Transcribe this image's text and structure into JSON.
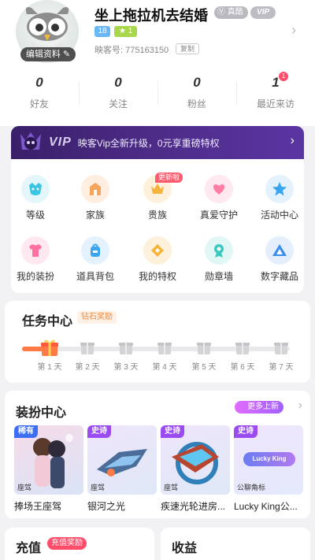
{
  "profile": {
    "username": "坐上拖拉机去结婚",
    "real_badge": "真酷",
    "vip_badge": "VIP",
    "edit_label": "编辑资料",
    "level": "18",
    "star_level": "1",
    "account": "映客号: 775163150",
    "copy_label": "复制"
  },
  "stats": [
    {
      "value": "0",
      "label": "好友"
    },
    {
      "value": "0",
      "label": "关注"
    },
    {
      "value": "0",
      "label": "粉丝"
    },
    {
      "value": "1",
      "label": "最近来访",
      "badge": "1"
    }
  ],
  "vip_banner": {
    "logo_text": "VIP",
    "text": "映客Vip全新升级，0元享重磅特权"
  },
  "grid": [
    {
      "label": "等级",
      "icon": "level-icon",
      "color": "#39c6e3"
    },
    {
      "label": "家族",
      "icon": "family-icon",
      "color": "#f6a65c"
    },
    {
      "label": "贵族",
      "icon": "crown-icon",
      "color": "#f6b33b",
      "tag": "更新啦"
    },
    {
      "label": "真爱守护",
      "icon": "heart-guard-icon",
      "color": "#ff7fa5"
    },
    {
      "label": "活动中心",
      "icon": "star-icon",
      "color": "#3aa6f0"
    },
    {
      "label": "我的装扮",
      "icon": "tshirt-icon",
      "color": "#ff6fa0"
    },
    {
      "label": "道具背包",
      "icon": "backpack-icon",
      "color": "#3aa6f0"
    },
    {
      "label": "我的特权",
      "icon": "diamond-icon",
      "color": "#f6b33b"
    },
    {
      "label": "勋章墙",
      "icon": "medal-icon",
      "color": "#3ac9c0"
    },
    {
      "label": "数字藏品",
      "icon": "collectible-icon",
      "color": "#3a8cf0"
    }
  ],
  "task_center": {
    "title": "任务中心",
    "tag": "钻石奖励",
    "days": [
      "第 1 天",
      "第 2 天",
      "第 3 天",
      "第 4 天",
      "第 5 天",
      "第 6 天",
      "第 7 天"
    ],
    "progress": 0.1
  },
  "dress_center": {
    "title": "装扮中心",
    "more_label": "更多上新",
    "items": [
      {
        "rarity": "稀有",
        "rarity_color": "#3b6ef0",
        "type": "座驾",
        "name": "捧场王座驾"
      },
      {
        "rarity": "史诗",
        "rarity_color": "#9a4cf0",
        "type": "座驾",
        "name": "银河之光"
      },
      {
        "rarity": "史诗",
        "rarity_color": "#9a4cf0",
        "type": "座驾",
        "name": "疾速光轮进房..."
      },
      {
        "rarity": "史诗",
        "rarity_color": "#9a4cf0",
        "type": "公聊角标",
        "name": "Lucky King公...",
        "inner_label": "Lucky King"
      }
    ]
  },
  "recharge": {
    "title": "充值",
    "tag": "充值奖励"
  },
  "income": {
    "title": "收益"
  }
}
